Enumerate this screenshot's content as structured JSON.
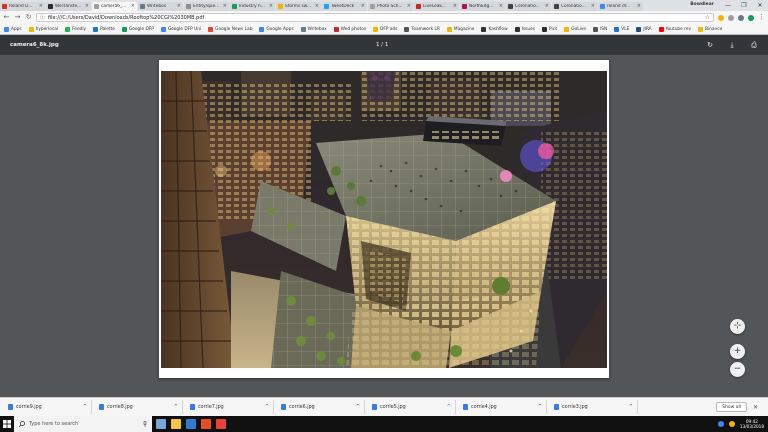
{
  "browser": {
    "tabs": [
      {
        "title": "Roland D...",
        "color": "#d93025",
        "active": false
      },
      {
        "title": "WeTransfe...",
        "color": "#2d2d2d",
        "active": false
      },
      {
        "title": "camera6_...",
        "color": "#9e9e9e",
        "active": true
      },
      {
        "title": "Writebox",
        "color": "#607d8b",
        "active": false
      },
      {
        "title": "Entity/que...",
        "color": "#8e8e8e",
        "active": false
      },
      {
        "title": "Industry h...",
        "color": "#0f9d58",
        "active": false
      },
      {
        "title": "Storms sw...",
        "color": "#f4b400",
        "active": false
      },
      {
        "title": "TweetDeck",
        "color": "#1da1f2",
        "active": false
      },
      {
        "title": "Photo Sch...",
        "color": "#9e9e9e",
        "active": false
      },
      {
        "title": "LiveLeak...",
        "color": "#c62828",
        "active": false
      },
      {
        "title": "NorthEdg...",
        "color": "#ad1457",
        "active": false
      },
      {
        "title": "Coronatio...",
        "color": "#424242",
        "active": false
      },
      {
        "title": "Coronatio...",
        "color": "#424242",
        "active": false
      },
      {
        "title": "roland dr...",
        "color": "#4285f4",
        "active": false
      }
    ],
    "profile_name": "Bowdlear",
    "window_controls": {
      "minimize": "—",
      "maximize": "❐",
      "close": "✕"
    },
    "nav": {
      "back": "←",
      "forward": "→",
      "reload": "↻"
    },
    "address": {
      "info_icon": "ⓘ",
      "url": "file:///C:/Users/David/Downloads/Rooftop%20CGI%2030MB.pdf",
      "star": "☆"
    },
    "extensions": [
      "#f4b400",
      "#9e9e9e",
      "#607d8b",
      "#0f9d58"
    ],
    "menu": "⋮",
    "bookmarks": [
      {
        "label": "Apps",
        "color": "#4285f4"
      },
      {
        "label": "hyperlocal",
        "color": "#f4b400"
      },
      {
        "label": "Feedly",
        "color": "#2bb24c"
      },
      {
        "label": "Palette",
        "color": "#1976d2"
      },
      {
        "label": "Google DFP",
        "color": "#0f9d58"
      },
      {
        "label": "Google DFP Uni",
        "color": "#4285f4"
      },
      {
        "label": "Google News Lab",
        "color": "#ea4335"
      },
      {
        "label": "Google Apps",
        "color": "#4285f4"
      },
      {
        "label": "Writebox",
        "color": "#607d8b"
      },
      {
        "label": "Wed photos",
        "color": "#c62828"
      },
      {
        "label": "DFP ads",
        "color": "#f4b400"
      },
      {
        "label": "Teamwork LR",
        "color": "#555555"
      },
      {
        "label": "Magazine",
        "color": "#f4b400"
      },
      {
        "label": "Kashflow",
        "color": "#333333"
      },
      {
        "label": "Issues",
        "color": "#333333"
      },
      {
        "label": "Pics",
        "color": "#2d2d2d"
      },
      {
        "label": "GoLive",
        "color": "#f4b400"
      },
      {
        "label": "ISN",
        "color": "#555555"
      },
      {
        "label": "VLE",
        "color": "#1976d2"
      },
      {
        "label": "JIRA",
        "color": "#205081"
      },
      {
        "label": "Youtube rev",
        "color": "#ff0000"
      },
      {
        "label": "Binance",
        "color": "#f0b90b"
      }
    ]
  },
  "pdf": {
    "title": "camera6_8k.jpg",
    "page_indicator": "1 / 1",
    "actions": {
      "rotate": "↻",
      "download": "⤓",
      "print": "⎙"
    },
    "zoom": {
      "fit": "⊹",
      "in": "+",
      "out": "−"
    }
  },
  "downloads": {
    "items": [
      "corrie9.jpg",
      "corrie8.jpg",
      "corrie7.jpg",
      "corrie6.jpg",
      "corrie5.jpg",
      "corrie4.jpg",
      "corrie3.jpg"
    ],
    "caret": "^",
    "show_all": "Show all",
    "close": "✕"
  },
  "taskbar": {
    "search_placeholder": "Type here to search",
    "apps": [
      "#7aa7d8",
      "#f4c542",
      "#2d7dd2",
      "#e44d26",
      "#ea4335"
    ],
    "tray": [
      "#4285f4",
      "#f4b400"
    ],
    "time": "09:42",
    "date": "13/03/2018"
  }
}
